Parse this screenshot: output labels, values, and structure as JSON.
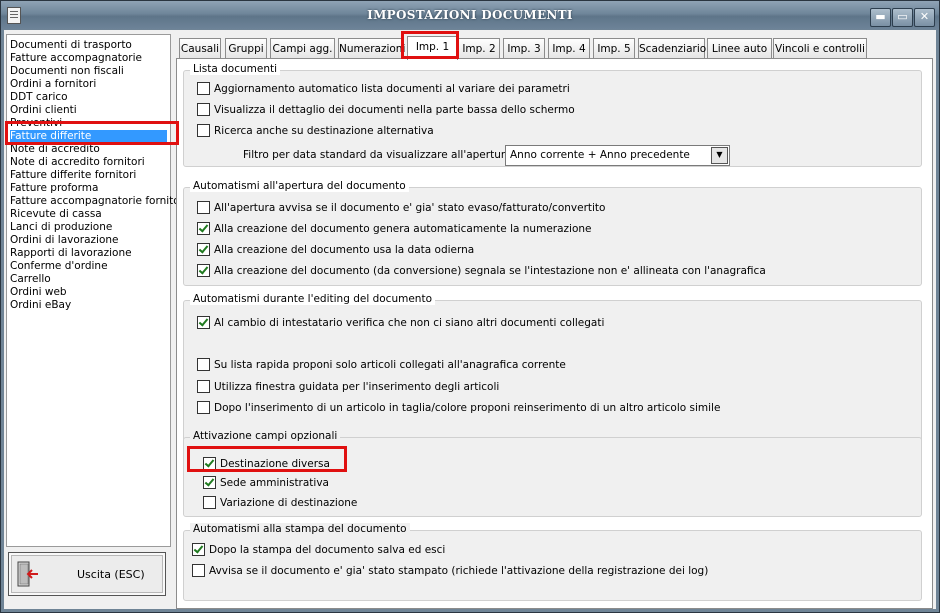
{
  "window": {
    "title": "IMPOSTAZIONI DOCUMENTI",
    "minimize_glyph": "▬",
    "maximize_glyph": "▭",
    "close_glyph": "✕"
  },
  "list": {
    "items": [
      "Documenti di trasporto",
      "Fatture accompagnatorie",
      "Documenti non fiscali",
      "Ordini a fornitori",
      "DDT carico",
      "Ordini clienti",
      "Preventivi",
      "Fatture differite",
      "Note di accredito",
      "Note di accredito fornitori",
      "Fatture differite fornitori",
      "Fatture proforma",
      "Fatture accompagnatorie fornito",
      "Ricevute di cassa",
      "Lanci di produzione",
      "Ordini di lavorazione",
      "Rapporti di lavorazione",
      "Conferme d'ordine",
      "Carrello",
      "Ordini web",
      "Ordini eBay"
    ],
    "selected": "Fatture differite"
  },
  "exit_button": {
    "label": "Uscita (ESC)",
    "icon": "door-exit-icon"
  },
  "tabs": [
    "Causali",
    "Gruppi",
    "Campi agg.",
    "Numerazioni",
    "Imp. 1",
    "Imp. 2",
    "Imp. 3",
    "Imp. 4",
    "Imp. 5",
    "Scadenziario",
    "Linee auto",
    "Vincoli e controlli"
  ],
  "active_tab": "Imp. 1",
  "groups": {
    "lista": {
      "title": "Lista documenti",
      "options": [
        {
          "label": "Aggiornamento automatico lista documenti al variare dei parametri",
          "checked": false
        },
        {
          "label": "Visualizza il dettaglio dei documenti nella parte bassa dello schermo",
          "checked": false
        },
        {
          "label": "Ricerca anche su destinazione alternativa",
          "checked": false
        }
      ],
      "filter_label": "Filtro per data standard da visualizzare all'apertura :",
      "filter_value": "Anno corrente + Anno precedente"
    },
    "apertura": {
      "title": "Automatismi all'apertura del documento",
      "options": [
        {
          "label": "All'apertura avvisa se il documento e' gia' stato evaso/fatturato/convertito",
          "checked": false
        },
        {
          "label": "Alla creazione del documento genera automaticamente la numerazione",
          "checked": true
        },
        {
          "label": "Alla creazione del documento usa la data odierna",
          "checked": true
        },
        {
          "label": "Alla creazione del documento (da conversione) segnala se l'intestazione non e' allineata con l'anagrafica",
          "checked": true
        }
      ]
    },
    "editing": {
      "title": "Automatismi durante l'editing del documento",
      "options": [
        {
          "label": "Al cambio di intestatario verifica che non ci siano altri documenti collegati",
          "checked": true
        },
        {
          "label": "Su lista rapida proponi solo articoli collegati all'anagrafica corrente",
          "checked": false
        },
        {
          "label": "Utilizza finestra guidata per l'inserimento degli articoli",
          "checked": false
        },
        {
          "label": "Dopo l'inserimento di un articolo in taglia/colore proponi reinserimento di un altro articolo simile",
          "checked": false
        }
      ]
    },
    "campi": {
      "title": "Attivazione campi opzionali",
      "options": [
        {
          "label": "Destinazione diversa",
          "checked": true
        },
        {
          "label": "Sede amministrativa",
          "checked": true
        },
        {
          "label": "Variazione di destinazione",
          "checked": false
        }
      ]
    },
    "stampa": {
      "title": "Automatismi alla stampa del documento",
      "options": [
        {
          "label": "Dopo la stampa del documento salva ed esci",
          "checked": true
        },
        {
          "label": "Avvisa se il documento e' gia' stato stampato (richiede l'attivazione della registrazione dei log)",
          "checked": false
        }
      ]
    }
  },
  "colors": {
    "highlight": "#e01010",
    "selection": "#3399ff",
    "titlebar": "#6f869a"
  }
}
